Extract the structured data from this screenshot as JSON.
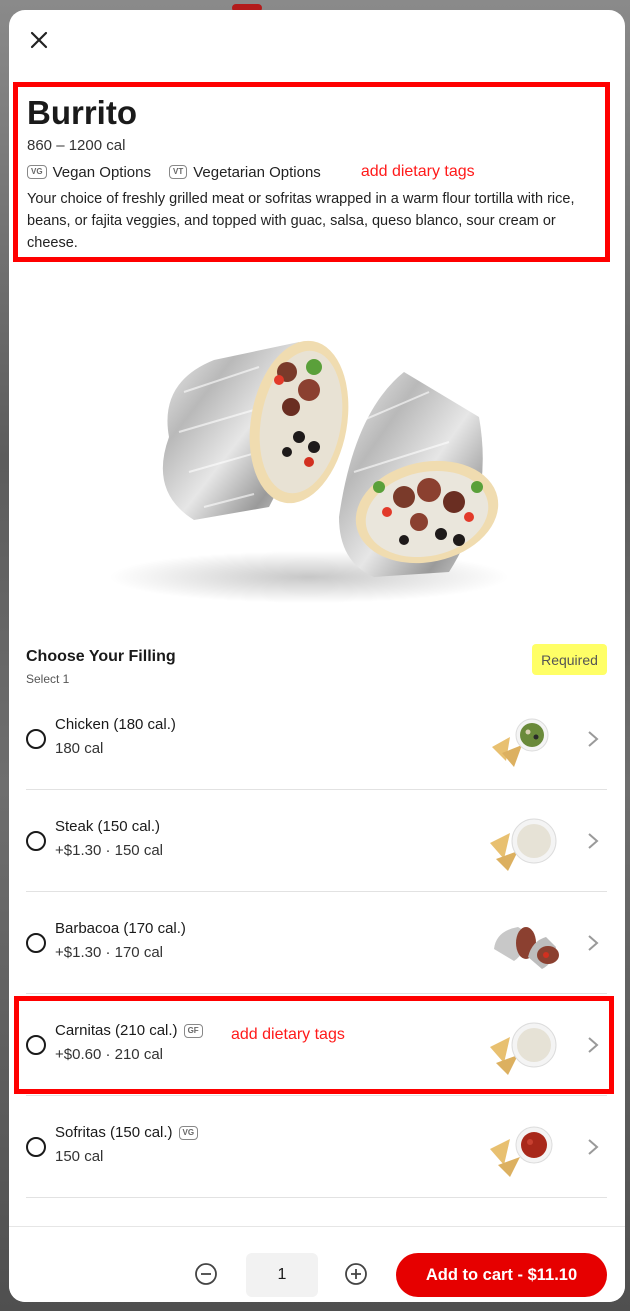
{
  "item": {
    "title": "Burrito",
    "calories": "860 – 1200 cal",
    "tags": [
      {
        "badge": "VG",
        "label": "Vegan Options"
      },
      {
        "badge": "VT",
        "label": "Vegetarian Options"
      }
    ],
    "description": "Your choice of freshly grilled meat or sofritas wrapped in a warm flour tortilla with rice, beans, or fajita veggies, and topped with guac, salsa, queso blanco, sour cream or cheese."
  },
  "annotations": {
    "header_note": "add dietary tags",
    "carnitas_note": "add dietary tags",
    "color": "#ff0000"
  },
  "filling": {
    "title": "Choose Your Filling",
    "subtitle": "Select 1",
    "required_label": "Required",
    "options": [
      {
        "name": "Chicken (180 cal.)",
        "badge": "",
        "sub": "180 cal",
        "thumb_icon": "chips-guac-icon"
      },
      {
        "name": "Steak (150 cal.)",
        "badge": "",
        "sub": "+$1.30 · 150 cal",
        "thumb_icon": "chips-queso-icon"
      },
      {
        "name": "Barbacoa (170 cal.)",
        "badge": "",
        "sub": "+$1.30 · 170 cal",
        "thumb_icon": "burrito-icon"
      },
      {
        "name": "Carnitas (210 cal.)",
        "badge": "GF",
        "sub": "+$0.60 · 210 cal",
        "thumb_icon": "chips-queso-icon"
      },
      {
        "name": "Sofritas (150 cal.)",
        "badge": "VG",
        "sub": "150 cal",
        "thumb_icon": "chips-salsa-icon"
      }
    ]
  },
  "footer": {
    "quantity": "1",
    "add_label": "Add to cart - $11.10"
  },
  "colors": {
    "accent": "#e60000",
    "required_bg": "#ffff66"
  }
}
